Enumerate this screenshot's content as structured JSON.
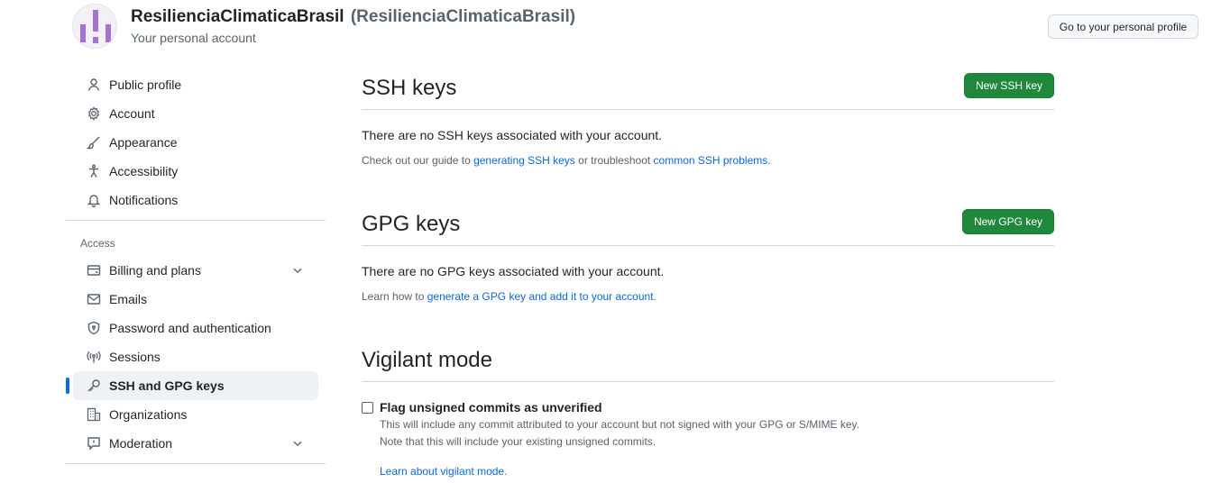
{
  "header": {
    "account_name": "ResilienciaClimaticaBrasil",
    "account_login": "(ResilienciaClimaticaBrasil)",
    "account_subtitle": "Your personal account",
    "profile_button": "Go to your personal profile"
  },
  "sidebar": {
    "items_top": [
      {
        "label": "Public profile",
        "icon": "person-icon"
      },
      {
        "label": "Account",
        "icon": "gear-icon"
      },
      {
        "label": "Appearance",
        "icon": "paintbrush-icon"
      },
      {
        "label": "Accessibility",
        "icon": "accessibility-icon"
      },
      {
        "label": "Notifications",
        "icon": "bell-icon"
      }
    ],
    "access_label": "Access",
    "items_access": [
      {
        "label": "Billing and plans",
        "icon": "credit-card-icon"
      },
      {
        "label": "Emails",
        "icon": "mail-icon"
      },
      {
        "label": "Password and authentication",
        "icon": "shield-lock-icon"
      },
      {
        "label": "Sessions",
        "icon": "broadcast-icon"
      },
      {
        "label": "SSH and GPG keys",
        "icon": "key-icon"
      },
      {
        "label": "Organizations",
        "icon": "organization-icon"
      },
      {
        "label": "Moderation",
        "icon": "report-icon"
      }
    ]
  },
  "ssh": {
    "title": "SSH keys",
    "new_button": "New SSH key",
    "empty_message": "There are no SSH keys associated with your account.",
    "hint_prefix": "Check out our guide to ",
    "hint_link1": "generating SSH keys",
    "hint_middle": " or troubleshoot ",
    "hint_link2": "common SSH problems",
    "hint_suffix": "."
  },
  "gpg": {
    "title": "GPG keys",
    "new_button": "New GPG key",
    "empty_message": "There are no GPG keys associated with your account.",
    "hint_prefix": "Learn how to ",
    "hint_link": "generate a GPG key and add it to your account",
    "hint_suffix": "."
  },
  "vigilant": {
    "title": "Vigilant mode",
    "checkbox_label": "Flag unsigned commits as unverified",
    "note_line1": "This will include any commit attributed to your account but not signed with your GPG or S/MIME key.",
    "note_line2": "Note that this will include your existing unsigned commits.",
    "learn_link": "Learn about vigilant mode."
  },
  "colors": {
    "accent": "#0969da",
    "primary_button": "#1f883d",
    "avatar": "#a273d3"
  }
}
